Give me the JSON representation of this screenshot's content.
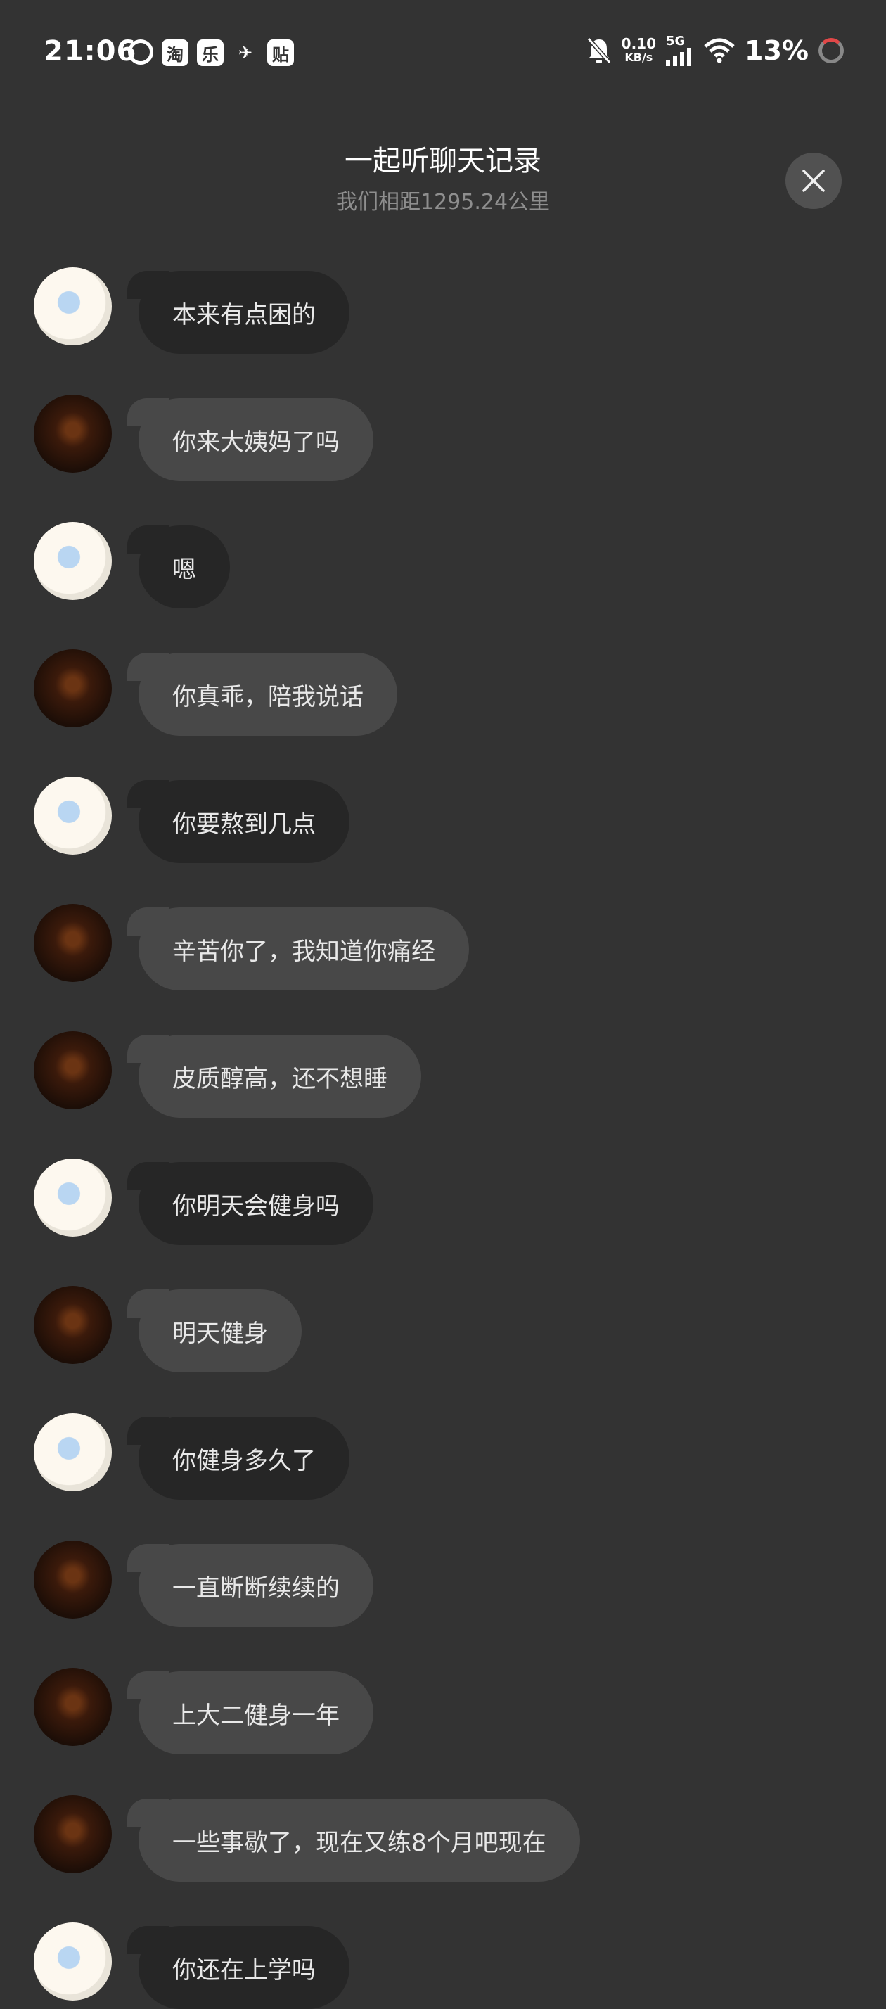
{
  "status_bar": {
    "time": "21:06",
    "app_icons": [
      "6",
      "淘",
      "乐",
      "✈",
      "贴"
    ],
    "net_speed_value": "0.10",
    "net_speed_unit": "KB/s",
    "network": "5G",
    "battery": "13%"
  },
  "header": {
    "title": "一起听聊天记录",
    "subtitle": "我们相距1295.24公里"
  },
  "messages": [
    {
      "sender": "self",
      "text": "本来有点困的"
    },
    {
      "sender": "other",
      "text": "你来大姨妈了吗"
    },
    {
      "sender": "self",
      "text": "嗯"
    },
    {
      "sender": "other",
      "text": "你真乖，陪我说话"
    },
    {
      "sender": "self",
      "text": "你要熬到几点"
    },
    {
      "sender": "other",
      "text": "辛苦你了，我知道你痛经"
    },
    {
      "sender": "other",
      "text": "皮质醇高，还不想睡"
    },
    {
      "sender": "self",
      "text": "你明天会健身吗"
    },
    {
      "sender": "other",
      "text": "明天健身"
    },
    {
      "sender": "self",
      "text": "你健身多久了"
    },
    {
      "sender": "other",
      "text": "一直断断续续的"
    },
    {
      "sender": "other",
      "text": "上大二健身一年"
    },
    {
      "sender": "other",
      "text": "一些事歇了，现在又练8个月吧现在"
    },
    {
      "sender": "self",
      "text": "你还在上学吗"
    }
  ],
  "colors": {
    "background": "#333333",
    "bubble_self": "#262626",
    "bubble_other": "#484848",
    "subtitle": "#8e8e8e"
  }
}
